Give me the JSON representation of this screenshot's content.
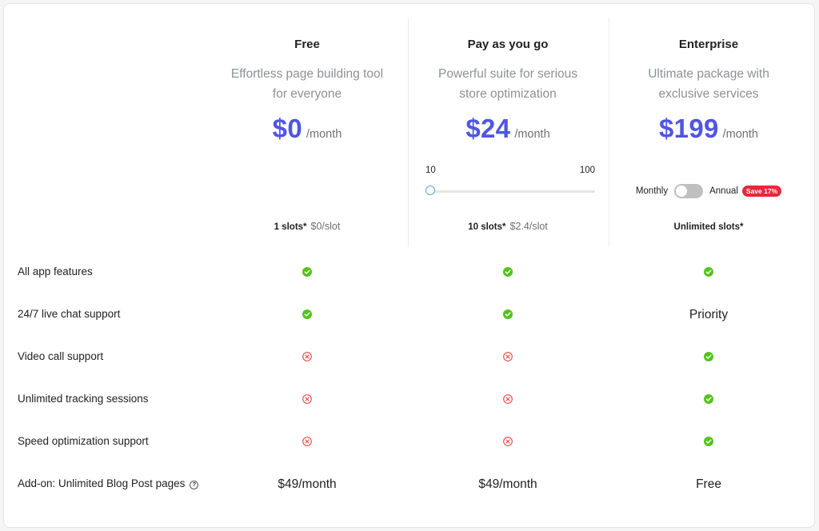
{
  "plans": [
    {
      "title": "Free",
      "description": "Effortless page building tool for everyone",
      "price": "$0",
      "period": "/month",
      "slots_label": "1 slots*",
      "rate": "$0/slot"
    },
    {
      "title": "Pay as you go",
      "description": "Powerful suite for serious store optimization",
      "price": "$24",
      "period": "/month",
      "slots_label": "10 slots*",
      "rate": "$2.4/slot",
      "slider": {
        "min": "10",
        "max": "100",
        "value": 10
      }
    },
    {
      "title": "Enterprise",
      "description": "Ultimate package with exclusive services",
      "price": "$199",
      "period": "/month",
      "slots_label": "Unlimited slots*",
      "billing": {
        "monthly": "Monthly",
        "annual": "Annual",
        "save_badge": "Save 17%",
        "selected": "Monthly"
      }
    }
  ],
  "features": [
    {
      "label": "All app features",
      "values": [
        "check",
        "check",
        "check"
      ]
    },
    {
      "label": "24/7 live chat support",
      "values": [
        "check",
        "check",
        "Priority"
      ]
    },
    {
      "label": "Video call support",
      "values": [
        "cross",
        "cross",
        "check"
      ]
    },
    {
      "label": "Unlimited tracking sessions",
      "values": [
        "cross",
        "cross",
        "check"
      ]
    },
    {
      "label": "Speed optimization support",
      "values": [
        "cross",
        "cross",
        "check"
      ]
    },
    {
      "label": "Add-on: Unlimited Blog Post pages",
      "values": [
        "$49/month",
        "$49/month",
        "Free"
      ],
      "help_icon": "question-circle-icon"
    }
  ],
  "colors": {
    "accent": "#4f55e4",
    "check": "#52c41a",
    "cross": "#e8473f",
    "badge": "#e8273b"
  }
}
